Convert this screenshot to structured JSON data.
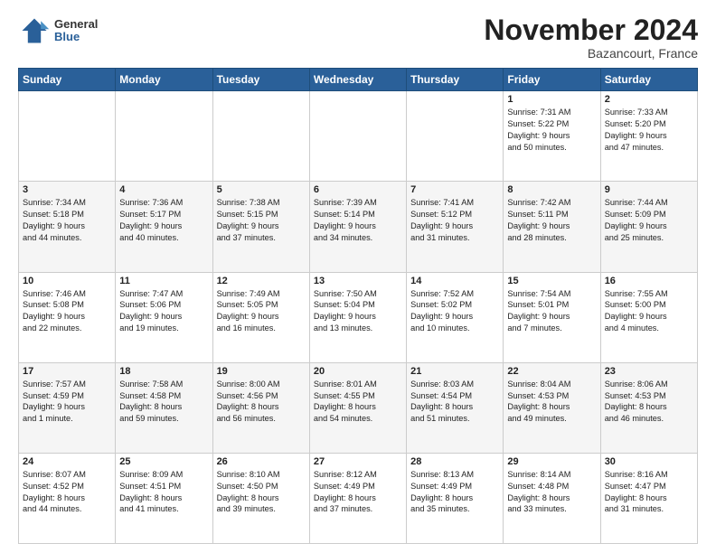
{
  "header": {
    "logo": {
      "general": "General",
      "blue": "Blue"
    },
    "title": "November 2024",
    "location": "Bazancourt, France"
  },
  "calendar": {
    "headers": [
      "Sunday",
      "Monday",
      "Tuesday",
      "Wednesday",
      "Thursday",
      "Friday",
      "Saturday"
    ],
    "rows": [
      [
        {
          "day": "",
          "info": ""
        },
        {
          "day": "",
          "info": ""
        },
        {
          "day": "",
          "info": ""
        },
        {
          "day": "",
          "info": ""
        },
        {
          "day": "",
          "info": ""
        },
        {
          "day": "1",
          "info": "Sunrise: 7:31 AM\nSunset: 5:22 PM\nDaylight: 9 hours\nand 50 minutes."
        },
        {
          "day": "2",
          "info": "Sunrise: 7:33 AM\nSunset: 5:20 PM\nDaylight: 9 hours\nand 47 minutes."
        }
      ],
      [
        {
          "day": "3",
          "info": "Sunrise: 7:34 AM\nSunset: 5:18 PM\nDaylight: 9 hours\nand 44 minutes."
        },
        {
          "day": "4",
          "info": "Sunrise: 7:36 AM\nSunset: 5:17 PM\nDaylight: 9 hours\nand 40 minutes."
        },
        {
          "day": "5",
          "info": "Sunrise: 7:38 AM\nSunset: 5:15 PM\nDaylight: 9 hours\nand 37 minutes."
        },
        {
          "day": "6",
          "info": "Sunrise: 7:39 AM\nSunset: 5:14 PM\nDaylight: 9 hours\nand 34 minutes."
        },
        {
          "day": "7",
          "info": "Sunrise: 7:41 AM\nSunset: 5:12 PM\nDaylight: 9 hours\nand 31 minutes."
        },
        {
          "day": "8",
          "info": "Sunrise: 7:42 AM\nSunset: 5:11 PM\nDaylight: 9 hours\nand 28 minutes."
        },
        {
          "day": "9",
          "info": "Sunrise: 7:44 AM\nSunset: 5:09 PM\nDaylight: 9 hours\nand 25 minutes."
        }
      ],
      [
        {
          "day": "10",
          "info": "Sunrise: 7:46 AM\nSunset: 5:08 PM\nDaylight: 9 hours\nand 22 minutes."
        },
        {
          "day": "11",
          "info": "Sunrise: 7:47 AM\nSunset: 5:06 PM\nDaylight: 9 hours\nand 19 minutes."
        },
        {
          "day": "12",
          "info": "Sunrise: 7:49 AM\nSunset: 5:05 PM\nDaylight: 9 hours\nand 16 minutes."
        },
        {
          "day": "13",
          "info": "Sunrise: 7:50 AM\nSunset: 5:04 PM\nDaylight: 9 hours\nand 13 minutes."
        },
        {
          "day": "14",
          "info": "Sunrise: 7:52 AM\nSunset: 5:02 PM\nDaylight: 9 hours\nand 10 minutes."
        },
        {
          "day": "15",
          "info": "Sunrise: 7:54 AM\nSunset: 5:01 PM\nDaylight: 9 hours\nand 7 minutes."
        },
        {
          "day": "16",
          "info": "Sunrise: 7:55 AM\nSunset: 5:00 PM\nDaylight: 9 hours\nand 4 minutes."
        }
      ],
      [
        {
          "day": "17",
          "info": "Sunrise: 7:57 AM\nSunset: 4:59 PM\nDaylight: 9 hours\nand 1 minute."
        },
        {
          "day": "18",
          "info": "Sunrise: 7:58 AM\nSunset: 4:58 PM\nDaylight: 8 hours\nand 59 minutes."
        },
        {
          "day": "19",
          "info": "Sunrise: 8:00 AM\nSunset: 4:56 PM\nDaylight: 8 hours\nand 56 minutes."
        },
        {
          "day": "20",
          "info": "Sunrise: 8:01 AM\nSunset: 4:55 PM\nDaylight: 8 hours\nand 54 minutes."
        },
        {
          "day": "21",
          "info": "Sunrise: 8:03 AM\nSunset: 4:54 PM\nDaylight: 8 hours\nand 51 minutes."
        },
        {
          "day": "22",
          "info": "Sunrise: 8:04 AM\nSunset: 4:53 PM\nDaylight: 8 hours\nand 49 minutes."
        },
        {
          "day": "23",
          "info": "Sunrise: 8:06 AM\nSunset: 4:53 PM\nDaylight: 8 hours\nand 46 minutes."
        }
      ],
      [
        {
          "day": "24",
          "info": "Sunrise: 8:07 AM\nSunset: 4:52 PM\nDaylight: 8 hours\nand 44 minutes."
        },
        {
          "day": "25",
          "info": "Sunrise: 8:09 AM\nSunset: 4:51 PM\nDaylight: 8 hours\nand 41 minutes."
        },
        {
          "day": "26",
          "info": "Sunrise: 8:10 AM\nSunset: 4:50 PM\nDaylight: 8 hours\nand 39 minutes."
        },
        {
          "day": "27",
          "info": "Sunrise: 8:12 AM\nSunset: 4:49 PM\nDaylight: 8 hours\nand 37 minutes."
        },
        {
          "day": "28",
          "info": "Sunrise: 8:13 AM\nSunset: 4:49 PM\nDaylight: 8 hours\nand 35 minutes."
        },
        {
          "day": "29",
          "info": "Sunrise: 8:14 AM\nSunset: 4:48 PM\nDaylight: 8 hours\nand 33 minutes."
        },
        {
          "day": "30",
          "info": "Sunrise: 8:16 AM\nSunset: 4:47 PM\nDaylight: 8 hours\nand 31 minutes."
        }
      ]
    ]
  }
}
